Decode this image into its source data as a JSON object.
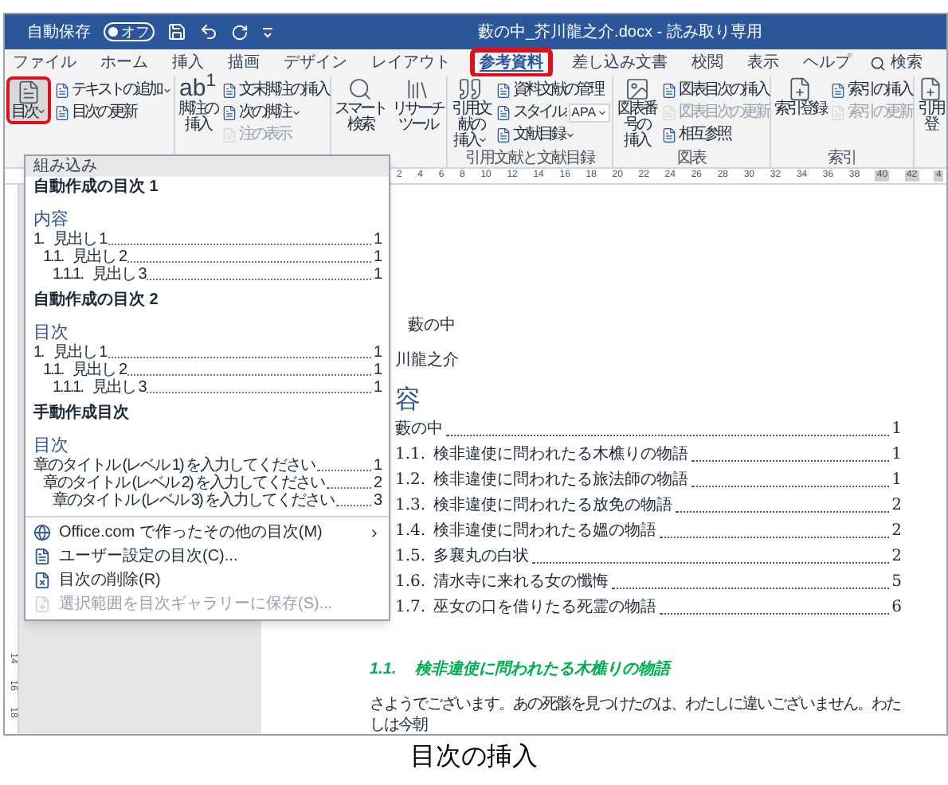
{
  "title_bar": {
    "autosave": {
      "label": "自動保存",
      "state_text": "オフ",
      "on": false
    },
    "document_title": "藪の中_芥川龍之介.docx - 読み取り専用"
  },
  "tabs": [
    {
      "label": "ファイル",
      "selected": false,
      "highlighted": false
    },
    {
      "label": "ホーム",
      "selected": false,
      "highlighted": false
    },
    {
      "label": "挿入",
      "selected": false,
      "highlighted": false
    },
    {
      "label": "描画",
      "selected": false,
      "highlighted": false
    },
    {
      "label": "デザイン",
      "selected": false,
      "highlighted": false
    },
    {
      "label": "レイアウト",
      "selected": false,
      "highlighted": false
    },
    {
      "label": "参考資料",
      "selected": true,
      "highlighted": true
    },
    {
      "label": "差し込み文書",
      "selected": false,
      "highlighted": false
    },
    {
      "label": "校閲",
      "selected": false,
      "highlighted": false
    },
    {
      "label": "表示",
      "selected": false,
      "highlighted": false
    },
    {
      "label": "ヘルプ",
      "selected": false,
      "highlighted": false
    }
  ],
  "search": {
    "label": "検索"
  },
  "ribbon_groups": [
    {
      "items": [
        {
          "kind": "large",
          "lines": [
            "目次"
          ],
          "dropdown": true,
          "highlighted": true
        },
        {
          "kind": "stack",
          "items": [
            {
              "label": "テキストの追加",
              "dropdown": true,
              "disabled": false
            },
            {
              "label": "目次の更新",
              "dropdown": false,
              "disabled": false
            }
          ]
        }
      ]
    },
    {
      "items": [
        {
          "kind": "large",
          "icon_text": "ab$^{1}$",
          "lines": [
            "脚注の",
            "挿入"
          ],
          "dropdown": false,
          "highlighted": false
        },
        {
          "kind": "stack",
          "items": [
            {
              "label": "文末脚注の挿入",
              "dropdown": false,
              "disabled": false
            },
            {
              "label": "次の脚注",
              "dropdown": true,
              "disabled": false
            },
            {
              "label": "注の表示",
              "dropdown": false,
              "disabled": true
            }
          ]
        }
      ]
    },
    {
      "items": [
        {
          "kind": "large",
          "lines": [
            "スマート",
            "検索"
          ],
          "dropdown": false,
          "highlighted": false
        },
        {
          "kind": "large",
          "lines": [
            "リサーチ",
            "ツール"
          ],
          "dropdown": false,
          "highlighted": false
        }
      ]
    },
    {
      "label": "引用文献と文献目録",
      "items": [
        {
          "kind": "large",
          "lines": [
            "引用文献の",
            "挿入"
          ],
          "dropdown": true,
          "highlighted": false
        },
        {
          "kind": "stack",
          "items": [
            {
              "label": "資料文献の管理",
              "dropdown": false,
              "disabled": false
            },
            {
              "label": "スタイル:",
              "value": "APA",
              "dropdown": true,
              "disabled": false
            },
            {
              "label": "文献目録",
              "dropdown": true,
              "disabled": false
            }
          ]
        }
      ]
    },
    {
      "label": "図表",
      "items": [
        {
          "kind": "large",
          "lines": [
            "図表番号の",
            "挿入"
          ],
          "dropdown": false,
          "highlighted": false
        },
        {
          "kind": "stack",
          "items": [
            {
              "label": "図表目次の挿入",
              "dropdown": false,
              "disabled": false
            },
            {
              "label": "図表目次の更新",
              "dropdown": false,
              "disabled": true
            },
            {
              "label": "相互参照",
              "dropdown": false,
              "disabled": false
            }
          ]
        }
      ]
    },
    {
      "label": "索引",
      "items": [
        {
          "kind": "large",
          "lines": [
            "索引登録"
          ],
          "dropdown": false,
          "highlighted": false
        },
        {
          "kind": "stack",
          "items": [
            {
              "label": "索引の挿入",
              "dropdown": false,
              "disabled": false
            },
            {
              "label": "索引の更新",
              "dropdown": false,
              "disabled": true
            }
          ]
        }
      ]
    },
    {
      "items": [
        {
          "kind": "large",
          "lines": [
            "引用",
            "登"
          ],
          "dropdown": false,
          "highlighted": false
        }
      ]
    }
  ],
  "ruler": {
    "numbers": [
      "2",
      "4",
      "6",
      "8",
      "10",
      "12",
      "14",
      "16",
      "18",
      "20",
      "22",
      "24",
      "26",
      "28",
      "30",
      "32",
      "34",
      "36",
      "38",
      "40",
      "42",
      "4"
    ],
    "vertical_numbers": [
      "14",
      "16",
      "18"
    ]
  },
  "toc_menu": {
    "header": "組み込み",
    "gallery": [
      {
        "title": "自動作成の目次 1",
        "heading": "内容",
        "lines": [
          {
            "number": "1.",
            "text": "見出し 1",
            "page": "1",
            "children": [
              {
                "number": "1.1.",
                "text": "見出し 2",
                "page": "1",
                "children": [
                  {
                    "number": "1.1.1.",
                    "text": "見出し 3",
                    "page": "1"
                  }
                ]
              }
            ]
          }
        ]
      },
      {
        "title": "自動作成の目次 2",
        "heading": "目次",
        "lines": [
          {
            "number": "1.",
            "text": "見出し 1",
            "page": "1",
            "children": [
              {
                "number": "1.1.",
                "text": "見出し 2",
                "page": "1",
                "children": [
                  {
                    "number": "1.1.1.",
                    "text": "見出し 3",
                    "page": "1"
                  }
                ]
              }
            ]
          }
        ]
      },
      {
        "title": "手動作成目次",
        "heading": "目次",
        "lines": [
          {
            "text": "章のタイトル (レベル 1) を入力してください",
            "page": "1",
            "children": [
              {
                "text": "章のタイトル (レベル 2) を入力してください",
                "page": "2",
                "children": [
                  {
                    "text": "章のタイトル (レベル 3) を入力してください",
                    "page": "3"
                  }
                ]
              }
            ]
          }
        ]
      }
    ],
    "commands": [
      {
        "kind": "more",
        "label": "Office.com で作ったその他の目次(M)",
        "submenu": true,
        "disabled": false
      },
      {
        "kind": "custom",
        "label": "ユーザー設定の目次(C)...",
        "submenu": false,
        "disabled": false
      },
      {
        "kind": "remove",
        "label": "目次の削除(R)",
        "submenu": false,
        "disabled": false
      },
      {
        "kind": "save",
        "label": "選択範囲を目次ギャラリーに保存(S)...",
        "submenu": false,
        "disabled": true
      }
    ]
  },
  "document": {
    "title": "藪の中",
    "author": "川龍之介",
    "toc_heading": "容",
    "toc": [
      {
        "title": "藪の中",
        "page": "1",
        "children": [
          {
            "number": "1.1.",
            "title": "検非違使に問われたる木樵りの物語",
            "page": "1"
          },
          {
            "number": "1.2.",
            "title": "検非違使に問われたる旅法師の物語",
            "page": "1"
          },
          {
            "number": "1.3.",
            "title": "検非違使に問われたる放免の物語",
            "page": "2"
          },
          {
            "number": "1.4.",
            "title": "検非違使に問われたる媼の物語",
            "page": "2"
          },
          {
            "number": "1.5.",
            "title": "多襄丸の白状",
            "page": "2"
          },
          {
            "number": "1.6.",
            "title": "清水寺に来れる女の懺悔",
            "page": "5"
          },
          {
            "number": "1.7.",
            "title": "巫女の口を借りたる死霊の物語",
            "page": "6"
          }
        ]
      }
    ],
    "heading": {
      "number": "1.1.",
      "title": "検非違使に問われたる木樵りの物語"
    },
    "body": "さようでございます。あの死骸を見つけたのは、わたしに違いございません。わたしは今朝"
  },
  "caption": "目次の挿入"
}
